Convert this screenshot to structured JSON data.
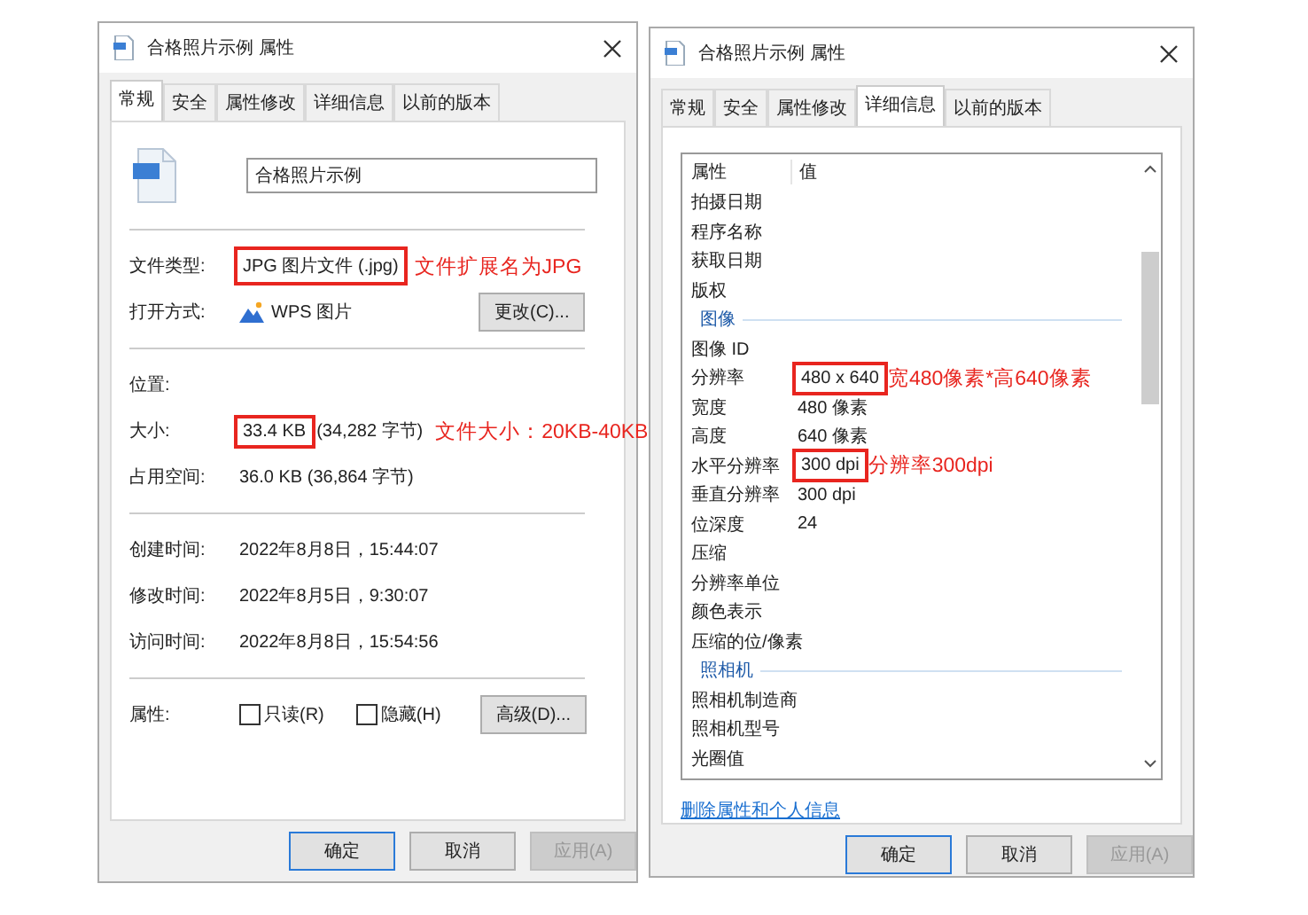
{
  "general_dialog": {
    "title": "合格照片示例 属性",
    "tabs": [
      {
        "label": "常规",
        "selected": true
      },
      {
        "label": "安全",
        "selected": false
      },
      {
        "label": "属性修改",
        "selected": false
      },
      {
        "label": "详细信息",
        "selected": false
      },
      {
        "label": "以前的版本",
        "selected": false
      }
    ],
    "file_name": "合格照片示例",
    "sections": [
      [
        {
          "kind": "text",
          "label": "文件类型:",
          "value": "JPG 图片文件 (.jpg)",
          "highlight": true,
          "note": "文件扩展名为JPG"
        },
        {
          "kind": "open_with",
          "label": "打开方式:",
          "value": "WPS 图片",
          "button": "更改(C)..."
        }
      ],
      [
        {
          "kind": "text",
          "label": "位置:"
        },
        {
          "kind": "text",
          "label": "大小:",
          "value": "33.4 KB",
          "highlight": true,
          "value_extra": "(34,282 字节)",
          "note": "文件大小：20KB-40KB"
        },
        {
          "kind": "text",
          "label": "占用空间:",
          "value": "36.0 KB (36,864 字节)",
          "highlight": false
        }
      ],
      [
        {
          "kind": "text",
          "label": "创建时间:",
          "value": "2022年8月8日，15:44:07",
          "highlight": false
        },
        {
          "kind": "text",
          "label": "修改时间:",
          "value": "2022年8月5日，9:30:07",
          "highlight": false
        },
        {
          "kind": "text",
          "label": "访问时间:",
          "value": "2022年8月8日，15:54:56",
          "highlight": false
        }
      ],
      [
        {
          "kind": "attributes",
          "label": "属性:",
          "checkboxes": [
            {
              "label": "只读(R)",
              "checked": false
            },
            {
              "label": "隐藏(H)",
              "checked": false
            }
          ],
          "button": "高级(D)..."
        }
      ]
    ],
    "buttons": [
      {
        "label": "确定",
        "default": true,
        "disabled": false
      },
      {
        "label": "取消",
        "default": false,
        "disabled": false
      },
      {
        "label": "应用(A)",
        "default": false,
        "disabled": true
      }
    ]
  },
  "details_dialog": {
    "title": "合格照片示例 属性",
    "tabs": [
      {
        "label": "常规",
        "selected": false
      },
      {
        "label": "安全",
        "selected": false
      },
      {
        "label": "属性修改",
        "selected": false
      },
      {
        "label": "详细信息",
        "selected": true
      },
      {
        "label": "以前的版本",
        "selected": false
      }
    ],
    "columns": [
      "属性",
      "值"
    ],
    "items": [
      {
        "kind": "row",
        "name": "拍摄日期"
      },
      {
        "kind": "row",
        "name": "程序名称"
      },
      {
        "kind": "row",
        "name": "获取日期"
      },
      {
        "kind": "row",
        "name": "版权"
      },
      {
        "kind": "group",
        "name": "图像"
      },
      {
        "kind": "row",
        "name": "图像 ID"
      },
      {
        "kind": "row",
        "name": "分辨率",
        "value": "480 x 640",
        "highlight": true,
        "note": "宽480像素*高640像素"
      },
      {
        "kind": "row",
        "name": "宽度",
        "value": "480 像素",
        "highlight": false
      },
      {
        "kind": "row",
        "name": "高度",
        "value": "640 像素",
        "highlight": false
      },
      {
        "kind": "row",
        "name": "水平分辨率",
        "value": "300 dpi",
        "highlight": true,
        "note": "分辨率300dpi"
      },
      {
        "kind": "row",
        "name": "垂直分辨率",
        "value": "300 dpi",
        "highlight": false
      },
      {
        "kind": "row",
        "name": "位深度",
        "value": "24",
        "highlight": false
      },
      {
        "kind": "row",
        "name": "压缩"
      },
      {
        "kind": "row",
        "name": "分辨率单位"
      },
      {
        "kind": "row",
        "name": "颜色表示"
      },
      {
        "kind": "row",
        "name": "压缩的位/像素"
      },
      {
        "kind": "group",
        "name": "照相机"
      },
      {
        "kind": "row",
        "name": "照相机制造商"
      },
      {
        "kind": "row",
        "name": "照相机型号"
      },
      {
        "kind": "row",
        "name": "光圈值"
      }
    ],
    "link": "删除属性和个人信息",
    "buttons": [
      {
        "label": "确定",
        "default": true,
        "disabled": false
      },
      {
        "label": "取消",
        "default": false,
        "disabled": false
      },
      {
        "label": "应用(A)",
        "default": false,
        "disabled": true
      }
    ]
  }
}
